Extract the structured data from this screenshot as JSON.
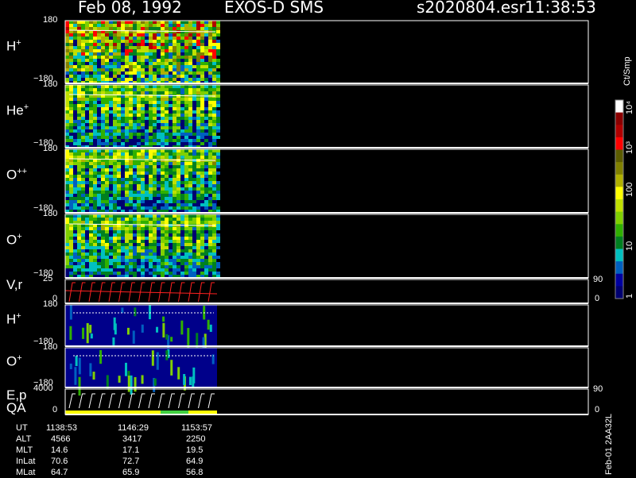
{
  "header": {
    "date": "Feb 08, 1992",
    "mission": "EXOS-D SMS",
    "file": "s2020804.esr",
    "time": "11:38:53"
  },
  "colorbar": {
    "unit": "Ct/Smp",
    "labels": [
      "10⁴",
      "10³",
      "100",
      "10",
      "1"
    ],
    "colors": [
      "#ffffff",
      "#8b0000",
      "#b00000",
      "#ff0000",
      "#5c5c00",
      "#808000",
      "#b0b000",
      "#ffff00",
      "#c0e000",
      "#80d000",
      "#30b000",
      "#008020",
      "#00c0c0",
      "#0060c0",
      "#0000a0",
      "#000070"
    ]
  },
  "panels": [
    {
      "id": "h-plus",
      "label": "H",
      "sup": "+",
      "ytop": "180",
      "ybot": "−180",
      "right_top": "",
      "right_bot": ""
    },
    {
      "id": "he-plus",
      "label": "He",
      "sup": "+",
      "ytop": "180",
      "ybot": "−180",
      "right_top": "",
      "right_bot": ""
    },
    {
      "id": "o-plusplus",
      "label": "O",
      "sup": "++",
      "ytop": "180",
      "ybot": "−180",
      "right_top": "",
      "right_bot": ""
    },
    {
      "id": "o-plus",
      "label": "O",
      "sup": "+",
      "ytop": "180",
      "ybot": "−180",
      "right_top": "",
      "right_bot": ""
    },
    {
      "id": "vr",
      "label": "V,r",
      "sup": "",
      "ytop": "25",
      "ybot": "0",
      "right_top": "90",
      "right_bot": "0"
    },
    {
      "id": "h-plus-2",
      "label": "H",
      "sup": "+",
      "ytop": "180",
      "ybot": "−180",
      "right_top": "",
      "right_bot": ""
    },
    {
      "id": "o-plus-2",
      "label": "O",
      "sup": "+",
      "ytop": "180",
      "ybot": "−180",
      "right_top": "",
      "right_bot": ""
    },
    {
      "id": "ep-qa",
      "label": "E,p",
      "label2": "QA",
      "sup": "",
      "ytop": "4000",
      "ybot": "0",
      "right_top": "90",
      "right_bot": "0"
    }
  ],
  "info": {
    "rows": [
      {
        "name": "UT",
        "values": [
          "1138:53",
          "1146:29",
          "1153:57"
        ]
      },
      {
        "name": "ALT",
        "values": [
          "4566",
          "3417",
          "2250"
        ]
      },
      {
        "name": "MLT",
        "values": [
          "14.6",
          "17.1",
          "19.5"
        ]
      },
      {
        "name": "InLat",
        "values": [
          "70.6",
          "72.7",
          "64.9"
        ]
      },
      {
        "name": "MLat",
        "values": [
          "64.7",
          "65.9",
          "56.8"
        ]
      }
    ]
  },
  "footer_id": "Feb-01 2AA32L",
  "chart_data": {
    "type": "heatmap",
    "title": "Feb 08, 1992   EXOS-D SMS",
    "x": [
      "1138:53",
      "1146:29",
      "1153:57"
    ],
    "series": [
      {
        "name": "H+",
        "ylim": [
          -180,
          180
        ]
      },
      {
        "name": "He+",
        "ylim": [
          -180,
          180
        ]
      },
      {
        "name": "O++",
        "ylim": [
          -180,
          180
        ]
      },
      {
        "name": "O+",
        "ylim": [
          -180,
          180
        ]
      },
      {
        "name": "V,r",
        "ylim": [
          0,
          25
        ]
      },
      {
        "name": "H+",
        "ylim": [
          -180,
          180
        ]
      },
      {
        "name": "O+",
        "ylim": [
          -180,
          180
        ]
      },
      {
        "name": "E,p",
        "ylim": [
          0,
          4000
        ]
      }
    ],
    "colorbar_scale": "log",
    "colorbar_range": [
      1,
      10000
    ],
    "colorbar_unit": "Ct/Smp"
  }
}
